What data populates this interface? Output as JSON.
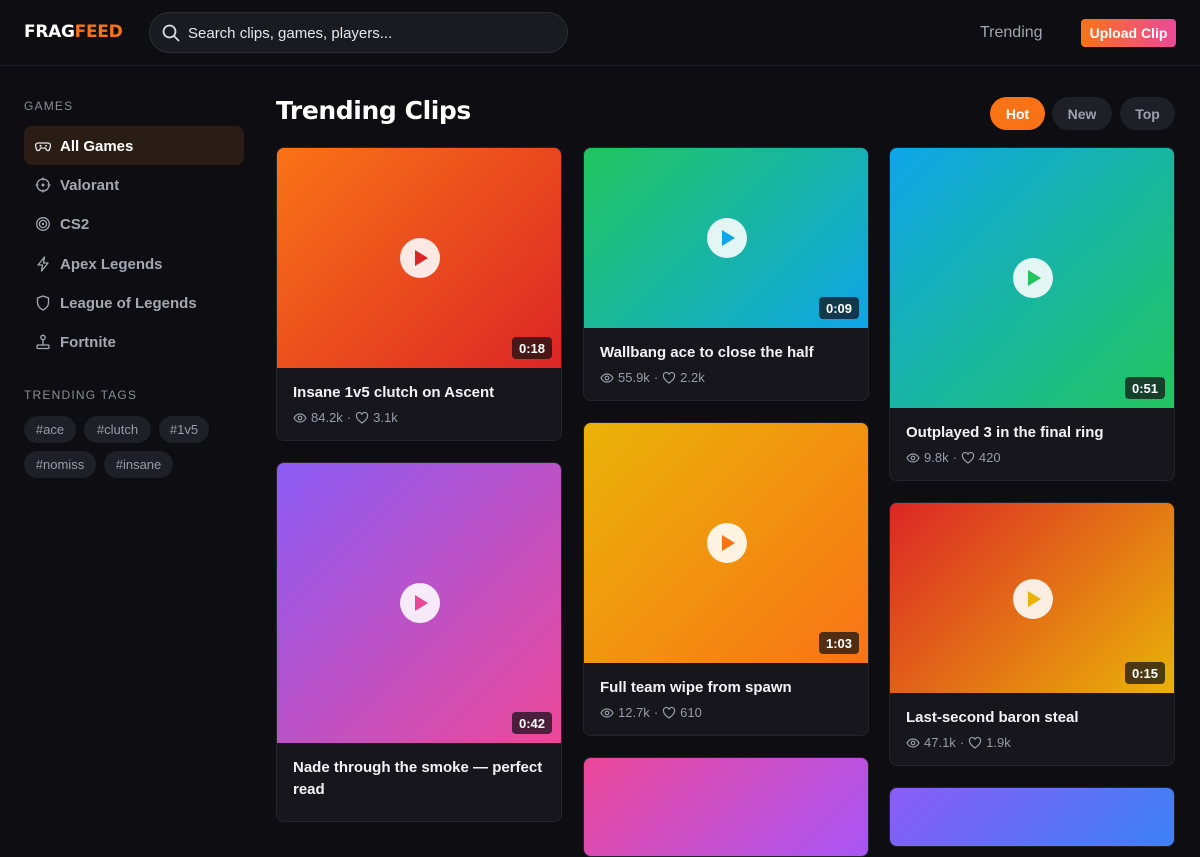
{
  "brand": {
    "name_part1": "FRAG",
    "name_part2": "FEED",
    "accent": "#f97316",
    "accent2": "#ec4899"
  },
  "search": {
    "text": "Search clips, games, players...",
    "icon": "search-icon"
  },
  "nav": {
    "trending": "Trending",
    "upload": "Upload Clip"
  },
  "sidebar": {
    "games_heading": "GAMES",
    "games": [
      {
        "label": "All Games",
        "icon": "gamepad-icon",
        "active": true
      },
      {
        "label": "Valorant",
        "icon": "crosshair-icon"
      },
      {
        "label": "CS2",
        "icon": "target-icon"
      },
      {
        "label": "Apex Legends",
        "icon": "lightning-icon"
      },
      {
        "label": "League of Legends",
        "icon": "shield-icon"
      },
      {
        "label": "Fortnite",
        "icon": "joystick-icon"
      }
    ],
    "tags_heading": "TRENDING TAGS",
    "tags": [
      "#ace",
      "#clutch",
      "#1v5",
      "#nomiss",
      "#insane"
    ]
  },
  "main": {
    "title": "Trending Clips",
    "filters": [
      {
        "label": "Hot",
        "active": true
      },
      {
        "label": "New"
      },
      {
        "label": "Top"
      }
    ],
    "clips": [
      {
        "title": "Insane 1v5 clutch on Ascent",
        "duration": "0:18",
        "views": "84.2k",
        "likes": "3.1k",
        "gradient": [
          "#f97316",
          "#dc2626"
        ]
      },
      {
        "title": "Wallbang ace to close the half",
        "duration": "0:09",
        "views": "55.9k",
        "likes": "2.2k",
        "gradient": [
          "#22c55e",
          "#0ea5e9"
        ]
      },
      {
        "title": "Outplayed 3 in the final ring",
        "duration": "0:51",
        "views": "9.8k",
        "likes": "420",
        "gradient": [
          "#0ea5e9",
          "#22c55e"
        ]
      },
      {
        "title": "Nade through the smoke — perfect read",
        "duration": "0:42",
        "views": "",
        "likes": "",
        "gradient": [
          "#8b5cf6",
          "#ec4899"
        ]
      },
      {
        "title": "Full team wipe from spawn",
        "duration": "1:03",
        "views": "12.7k",
        "likes": "610",
        "gradient": [
          "#eab308",
          "#f97316"
        ]
      },
      {
        "title": "Last-second baron steal",
        "duration": "0:15",
        "views": "47.1k",
        "likes": "1.9k",
        "gradient": [
          "#dc2626",
          "#eab308"
        ]
      },
      {
        "title": "",
        "duration": "",
        "views": "",
        "likes": "",
        "gradient": [
          "#ec4899",
          "#a855f7"
        ]
      },
      {
        "title": "",
        "duration": "",
        "views": "",
        "likes": "",
        "gradient": [
          "#8b5cf6",
          "#3b82f6"
        ]
      }
    ]
  }
}
